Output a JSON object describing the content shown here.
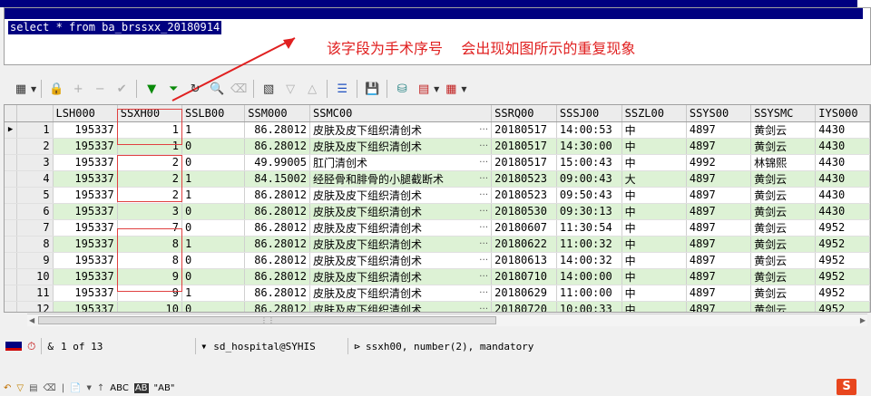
{
  "editor": {
    "sql": "select * from ba_brssxx_20180914"
  },
  "annotation": {
    "text": "该字段为手术序号    会出现如图所示的重复现象"
  },
  "toolbar": {
    "icons": [
      "grid-icon",
      "lock-icon",
      "add-record-icon",
      "delete-record-icon",
      "post-changes-icon",
      "fetch-next-icon",
      "fetch-last-icon",
      "refresh-icon",
      "find-icon",
      "clear-icon",
      "query-by-example-icon",
      "previous-icon",
      "next-icon",
      "tree-icon",
      "save-icon",
      "export-icon",
      "chart-icon",
      "table-icon"
    ]
  },
  "grid": {
    "columns": [
      "LSH000",
      "SSXH00",
      "SSLB00",
      "SSM000",
      "SSMC00",
      "SSRQ00",
      "SSSJ00",
      "SSZL00",
      "SSYS00",
      "SSYSMC",
      "IYS000"
    ],
    "rows": [
      {
        "n": "1",
        "lsh": "195337",
        "ssxh": "1",
        "sslb": "1",
        "ssm": "86.28012",
        "ssmc": "皮肤及皮下组织清创术",
        "ssrq": "20180517",
        "sssj": "14:00:53",
        "sszl": "中",
        "ssys": "4897",
        "ssysmc": "黄剑云",
        "iys": "4430"
      },
      {
        "n": "2",
        "lsh": "195337",
        "ssxh": "1",
        "sslb": "0",
        "ssm": "86.28012",
        "ssmc": "皮肤及皮下组织清创术",
        "ssrq": "20180517",
        "sssj": "14:30:00",
        "sszl": "中",
        "ssys": "4897",
        "ssysmc": "黄剑云",
        "iys": "4430"
      },
      {
        "n": "3",
        "lsh": "195337",
        "ssxh": "2",
        "sslb": "0",
        "ssm": "49.99005",
        "ssmc": "肛门清创术",
        "ssrq": "20180517",
        "sssj": "15:00:43",
        "sszl": "中",
        "ssys": "4992",
        "ssysmc": "林锦熙",
        "iys": "4430"
      },
      {
        "n": "4",
        "lsh": "195337",
        "ssxh": "2",
        "sslb": "1",
        "ssm": "84.15002",
        "ssmc": "经胫骨和腓骨的小腿截断术",
        "ssrq": "20180523",
        "sssj": "09:00:43",
        "sszl": "大",
        "ssys": "4897",
        "ssysmc": "黄剑云",
        "iys": "4430"
      },
      {
        "n": "5",
        "lsh": "195337",
        "ssxh": "2",
        "sslb": "1",
        "ssm": "86.28012",
        "ssmc": "皮肤及皮下组织清创术",
        "ssrq": "20180523",
        "sssj": "09:50:43",
        "sszl": "中",
        "ssys": "4897",
        "ssysmc": "黄剑云",
        "iys": "4430"
      },
      {
        "n": "6",
        "lsh": "195337",
        "ssxh": "3",
        "sslb": "0",
        "ssm": "86.28012",
        "ssmc": "皮肤及皮下组织清创术",
        "ssrq": "20180530",
        "sssj": "09:30:13",
        "sszl": "中",
        "ssys": "4897",
        "ssysmc": "黄剑云",
        "iys": "4430"
      },
      {
        "n": "7",
        "lsh": "195337",
        "ssxh": "7",
        "sslb": "0",
        "ssm": "86.28012",
        "ssmc": "皮肤及皮下组织清创术",
        "ssrq": "20180607",
        "sssj": "11:30:54",
        "sszl": "中",
        "ssys": "4897",
        "ssysmc": "黄剑云",
        "iys": "4952"
      },
      {
        "n": "8",
        "lsh": "195337",
        "ssxh": "8",
        "sslb": "1",
        "ssm": "86.28012",
        "ssmc": "皮肤及皮下组织清创术",
        "ssrq": "20180622",
        "sssj": "11:00:32",
        "sszl": "中",
        "ssys": "4897",
        "ssysmc": "黄剑云",
        "iys": "4952"
      },
      {
        "n": "9",
        "lsh": "195337",
        "ssxh": "8",
        "sslb": "0",
        "ssm": "86.28012",
        "ssmc": "皮肤及皮下组织清创术",
        "ssrq": "20180613",
        "sssj": "14:00:32",
        "sszl": "中",
        "ssys": "4897",
        "ssysmc": "黄剑云",
        "iys": "4952"
      },
      {
        "n": "10",
        "lsh": "195337",
        "ssxh": "9",
        "sslb": "0",
        "ssm": "86.28012",
        "ssmc": "皮肤及皮下组织清创术",
        "ssrq": "20180710",
        "sssj": "14:00:00",
        "sszl": "中",
        "ssys": "4897",
        "ssysmc": "黄剑云",
        "iys": "4952"
      },
      {
        "n": "11",
        "lsh": "195337",
        "ssxh": "9",
        "sslb": "1",
        "ssm": "86.28012",
        "ssmc": "皮肤及皮下组织清创术",
        "ssrq": "20180629",
        "sssj": "11:00:00",
        "sszl": "中",
        "ssys": "4897",
        "ssysmc": "黄剑云",
        "iys": "4952"
      },
      {
        "n": "12",
        "lsh": "195337",
        "ssxh": "10",
        "sslb": "0",
        "ssm": "86.28012",
        "ssmc": "皮肤及皮下组织清创术",
        "ssrq": "20180720",
        "sssj": "10:00:33",
        "sszl": "中",
        "ssys": "4897",
        "ssysmc": "黄剑云",
        "iys": "4952"
      }
    ]
  },
  "status": {
    "record_position": "1 of 13",
    "connection": "sd_hospital@SYHIS",
    "column_info": "ssxh00, number(2), mandatory"
  },
  "bottom_toolbar": {
    "abc_label": "ABC",
    "ab_label": "\"AB\""
  },
  "colors": {
    "annotation": "#e02020",
    "selection": "#000080",
    "row_even": "#ddf2d5"
  }
}
